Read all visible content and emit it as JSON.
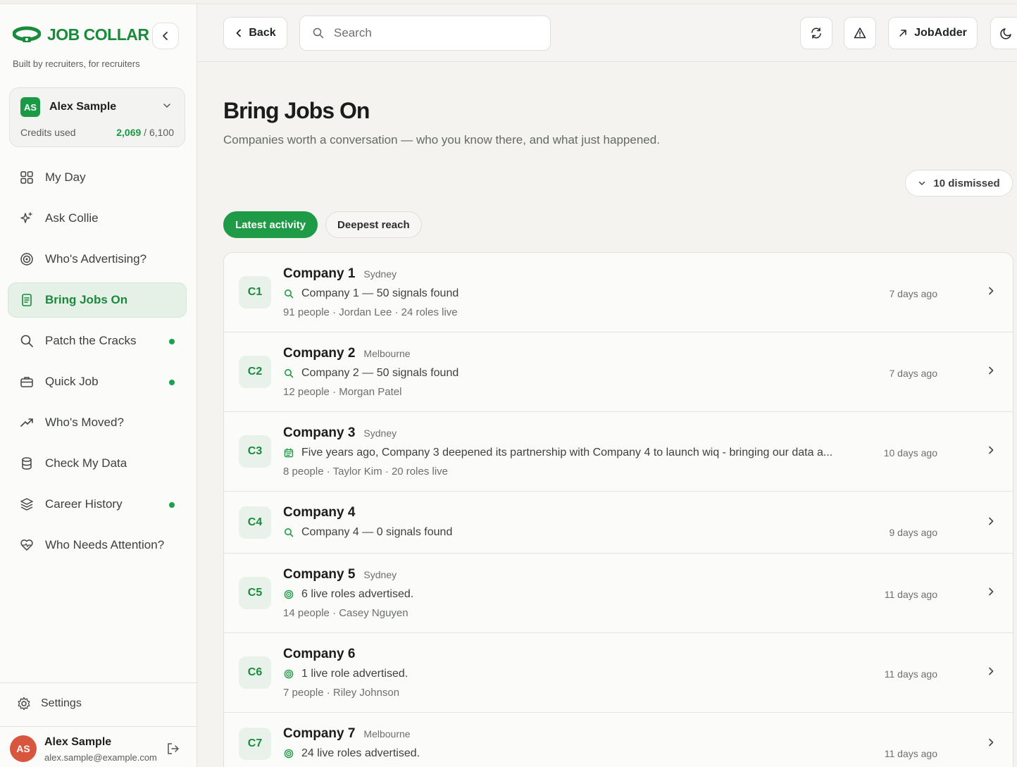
{
  "brand": {
    "name": "JOB COLLAR",
    "tagline": "Built by recruiters, for recruiters",
    "color": "#1a8a3c"
  },
  "account": {
    "initials": "AS",
    "name": "Alex Sample",
    "credits_label": "Credits used",
    "credits_used": "2,069",
    "credits_total": " / 6,100"
  },
  "nav": [
    {
      "label": "My Day",
      "icon": "grid-icon",
      "active": false,
      "dot": false
    },
    {
      "label": "Ask Collie",
      "icon": "sparkle-icon",
      "active": false,
      "dot": false
    },
    {
      "label": "Who's Advertising?",
      "icon": "target-icon",
      "active": false,
      "dot": false
    },
    {
      "label": "Bring Jobs On",
      "icon": "document-icon",
      "active": true,
      "dot": false
    },
    {
      "label": "Patch the Cracks",
      "icon": "search-icon",
      "active": false,
      "dot": true
    },
    {
      "label": "Quick Job",
      "icon": "briefcase-icon",
      "active": false,
      "dot": true
    },
    {
      "label": "Who's Moved?",
      "icon": "trend-up-icon",
      "active": false,
      "dot": false
    },
    {
      "label": "Check My Data",
      "icon": "database-icon",
      "active": false,
      "dot": false
    },
    {
      "label": "Career History",
      "icon": "layers-icon",
      "active": false,
      "dot": true
    },
    {
      "label": "Who Needs Attention?",
      "icon": "heart-pulse-icon",
      "active": false,
      "dot": false
    }
  ],
  "settings_label": "Settings",
  "user": {
    "initials": "AS",
    "name": "Alex Sample",
    "email": "alex.sample@example.com"
  },
  "topbar": {
    "back_label": "Back",
    "search_placeholder": "Search",
    "jobadder_label": "JobAdder"
  },
  "page": {
    "title": "Bring Jobs On",
    "subtitle": "Companies worth a conversation — who you know there, and what just happened.",
    "dismissed_label": "10 dismissed"
  },
  "tabs": [
    {
      "label": "Latest activity",
      "active": true
    },
    {
      "label": "Deepest reach",
      "active": false
    }
  ],
  "companies": [
    {
      "badge": "C1",
      "name": "Company 1",
      "location": "Sydney",
      "signal_icon": "search-icon",
      "signal": "Company 1 — 50 signals found",
      "meta": "91 people · Jordan Lee · 24 roles live",
      "time": "7 days ago"
    },
    {
      "badge": "C2",
      "name": "Company 2",
      "location": "Melbourne",
      "signal_icon": "search-icon",
      "signal": "Company 2 — 50 signals found",
      "meta": "12 people · Morgan Patel",
      "time": "7 days ago"
    },
    {
      "badge": "C3",
      "name": "Company 3",
      "location": "Sydney",
      "signal_icon": "calendar-icon",
      "signal": "Five years ago, Company 3 deepened its partnership with Company 4 to launch wiq - bringing our data a...",
      "meta": "8 people · Taylor Kim · 20 roles live",
      "time": "10 days ago"
    },
    {
      "badge": "C4",
      "name": "Company 4",
      "location": "",
      "signal_icon": "search-icon",
      "signal": "Company 4 — 0 signals found",
      "meta": "",
      "time": "9 days ago"
    },
    {
      "badge": "C5",
      "name": "Company 5",
      "location": "Sydney",
      "signal_icon": "target-icon",
      "signal": "6 live roles advertised.",
      "meta": "14 people · Casey Nguyen",
      "time": "11 days ago"
    },
    {
      "badge": "C6",
      "name": "Company 6",
      "location": "",
      "signal_icon": "target-icon",
      "signal": "1 live role advertised.",
      "meta": "7 people ·  Riley Johnson",
      "time": "11 days ago"
    },
    {
      "badge": "C7",
      "name": "Company 7",
      "location": "Melbourne",
      "signal_icon": "target-icon",
      "signal": "24 live roles advertised.",
      "meta": "",
      "time": "11 days ago"
    }
  ]
}
